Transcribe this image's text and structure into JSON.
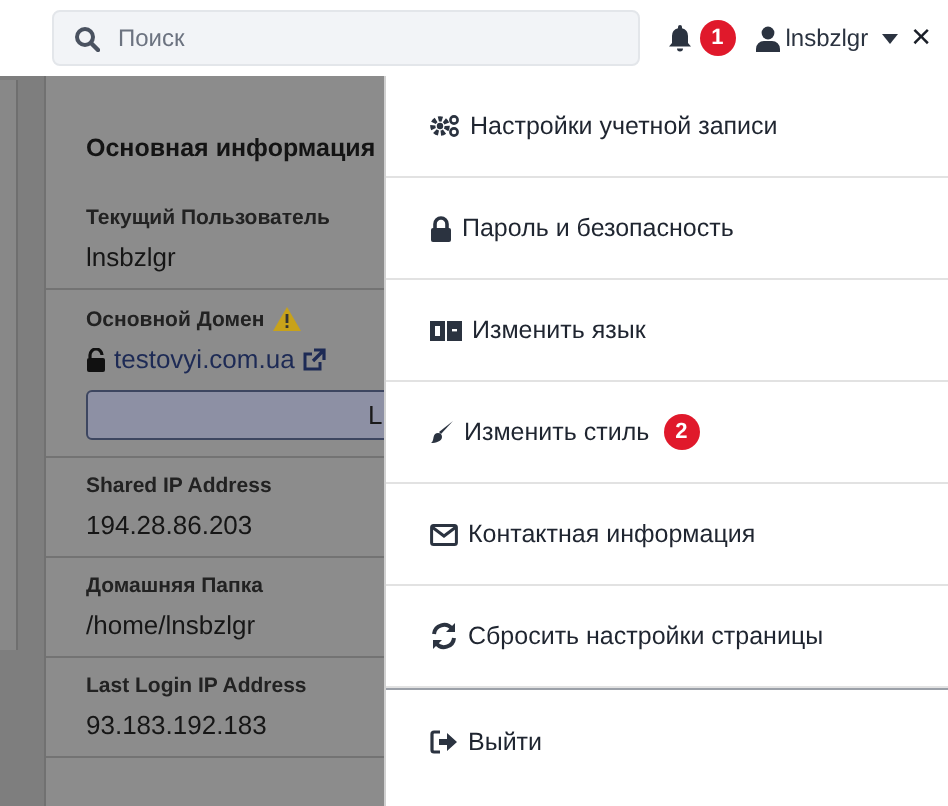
{
  "header": {
    "search": {
      "placeholder": "Поиск"
    },
    "notifications": {
      "count": "1"
    },
    "user": {
      "name": "lnsbzlgr"
    },
    "close": "✕"
  },
  "card": {
    "title": "Основная информация",
    "fields": [
      {
        "kind": "text",
        "label": "Текущий Пользователь",
        "value": "lnsbzlgr"
      },
      {
        "kind": "domain",
        "label": "Основной Домен",
        "value": "testovyi.com.ua",
        "button": "L"
      },
      {
        "kind": "text",
        "label": "Shared IP Address",
        "value": "194.28.86.203"
      },
      {
        "kind": "text",
        "label": "Домашняя Папка",
        "value": "/home/lnsbzlgr"
      },
      {
        "kind": "text",
        "label": "Last Login IP Address",
        "value": "93.183.192.183"
      }
    ]
  },
  "menu": {
    "items": [
      {
        "kind": "item",
        "label": "Настройки учетной записи"
      },
      {
        "kind": "item",
        "label": "Пароль и безопасность"
      },
      {
        "kind": "item",
        "label": "Изменить язык"
      },
      {
        "kind": "item",
        "label": "Изменить стиль",
        "badge": "2"
      },
      {
        "kind": "item",
        "label": "Контактная информация"
      },
      {
        "kind": "item",
        "label": "Сбросить настройки страницы"
      },
      {
        "kind": "logout",
        "label": "Выйти"
      }
    ]
  }
}
